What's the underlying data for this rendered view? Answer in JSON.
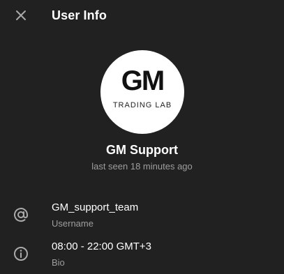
{
  "header": {
    "title": "User Info",
    "close_icon": "close-icon"
  },
  "profile": {
    "avatar": {
      "logo_main": "GM",
      "logo_sub": "TRADING LAB",
      "background": "#ffffff"
    },
    "name": "GM Support",
    "status": "last seen 18 minutes ago"
  },
  "info": {
    "username": {
      "icon": "at-sign-icon",
      "value": "GM_support_team",
      "label": "Username"
    },
    "bio": {
      "icon": "info-icon",
      "value": "08:00 - 22:00 GMT+3",
      "label": "Bio"
    }
  },
  "colors": {
    "background": "#212121",
    "primary_text": "#ffffff",
    "secondary_text": "#9e9e9e",
    "icon": "#aaaaaa"
  }
}
